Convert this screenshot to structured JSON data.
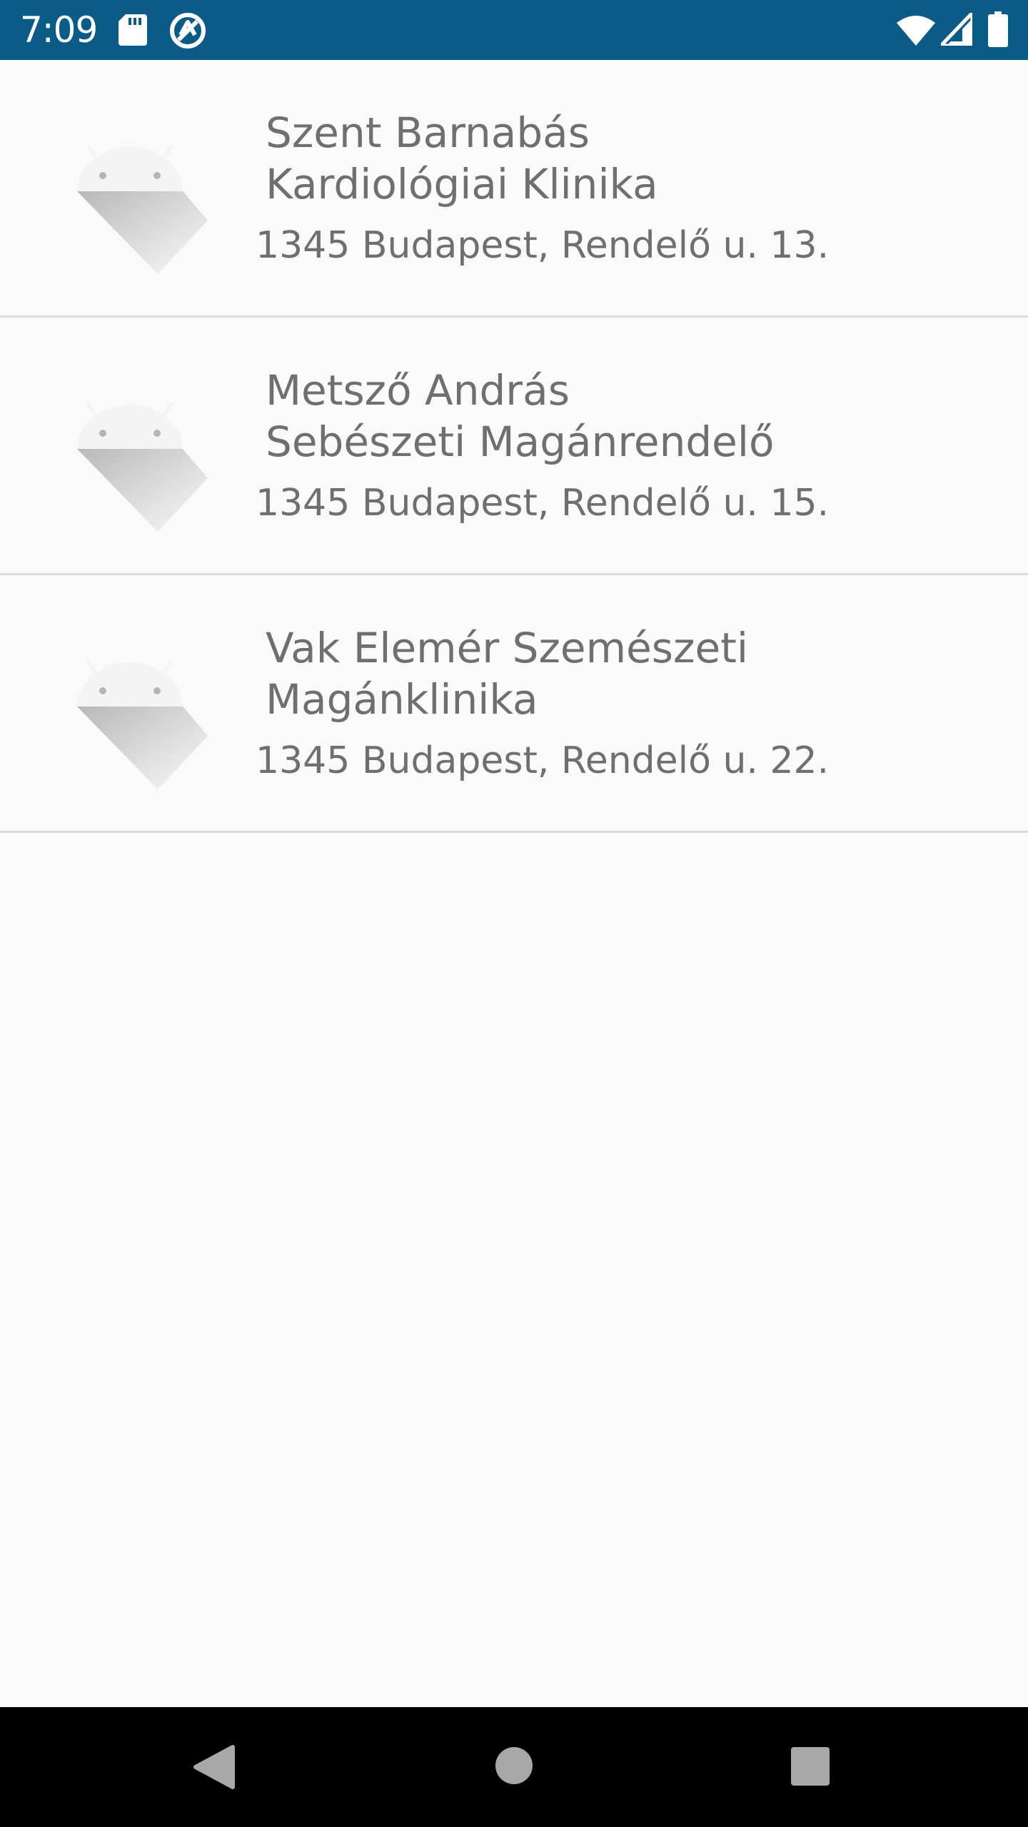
{
  "status_bar": {
    "time": "7:09",
    "background_color": "#0b5b87",
    "icons": [
      "sd-card-icon",
      "sync-icon",
      "wifi-icon",
      "signal-icon",
      "battery-icon"
    ]
  },
  "clinics": [
    {
      "title": "Szent Barnabás\nKardiológiai Klinika",
      "address": "1345 Budapest, Rendelő u. 13.",
      "image": "android-placeholder-icon"
    },
    {
      "title": "Metsző András\nSebészeti Magánrendelő",
      "address": "1345 Budapest, Rendelő u. 15.",
      "image": "android-placeholder-icon"
    },
    {
      "title": "Vak Elemér Szemészeti\nMagánklinika",
      "address": "1345 Budapest, Rendelő u. 22.",
      "image": "android-placeholder-icon"
    }
  ],
  "nav_bar": {
    "buttons": [
      "back-icon",
      "home-icon",
      "recents-icon"
    ]
  },
  "colors": {
    "text": "#6f6f6f",
    "divider": "#dcdcdc",
    "background": "#fafafa"
  }
}
